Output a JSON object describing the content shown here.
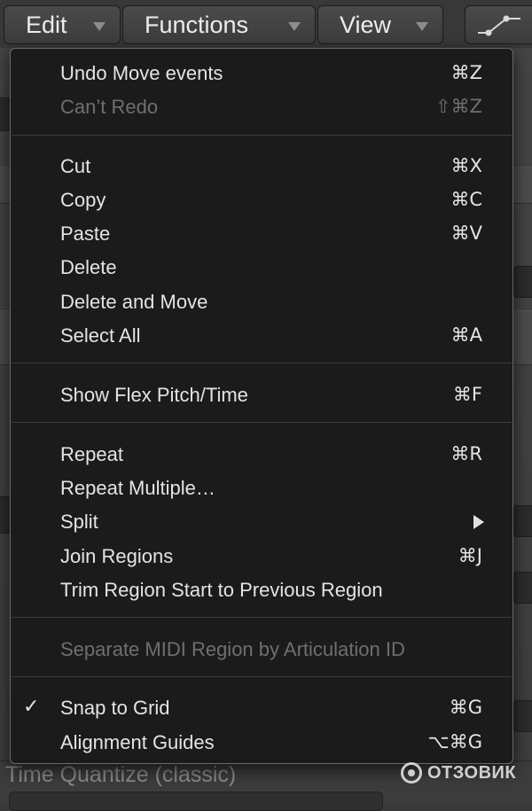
{
  "menubar": {
    "edit": "Edit",
    "functions": "Functions",
    "view": "View"
  },
  "background": {
    "quantize_label": "Time Quantize (classic)"
  },
  "watermark": {
    "text": "ОТЗОВИК"
  },
  "edit_menu": {
    "undo": {
      "label": "Undo Move events",
      "shortcut": "⌘Z"
    },
    "redo": {
      "label": "Can’t Redo",
      "shortcut": "⇧⌘Z"
    },
    "cut": {
      "label": "Cut",
      "shortcut": "⌘X"
    },
    "copy": {
      "label": "Copy",
      "shortcut": "⌘C"
    },
    "paste": {
      "label": "Paste",
      "shortcut": "⌘V"
    },
    "delete": {
      "label": "Delete"
    },
    "delete_and_move": {
      "label": "Delete and Move"
    },
    "select_all": {
      "label": "Select All",
      "shortcut": "⌘A"
    },
    "show_flex": {
      "label": "Show Flex Pitch/Time",
      "shortcut": "⌘F"
    },
    "repeat": {
      "label": "Repeat",
      "shortcut": "⌘R"
    },
    "repeat_multiple": {
      "label": "Repeat Multiple…"
    },
    "split": {
      "label": "Split"
    },
    "join_regions": {
      "label": "Join Regions",
      "shortcut": "⌘J"
    },
    "trim_region": {
      "label": "Trim Region Start to Previous Region"
    },
    "separate_midi": {
      "label": "Separate MIDI Region by Articulation ID"
    },
    "snap_to_grid": {
      "label": "Snap to Grid",
      "shortcut": "⌘G",
      "check": "✓"
    },
    "alignment_guides": {
      "label": "Alignment Guides",
      "shortcut": "⌥⌘G"
    }
  }
}
